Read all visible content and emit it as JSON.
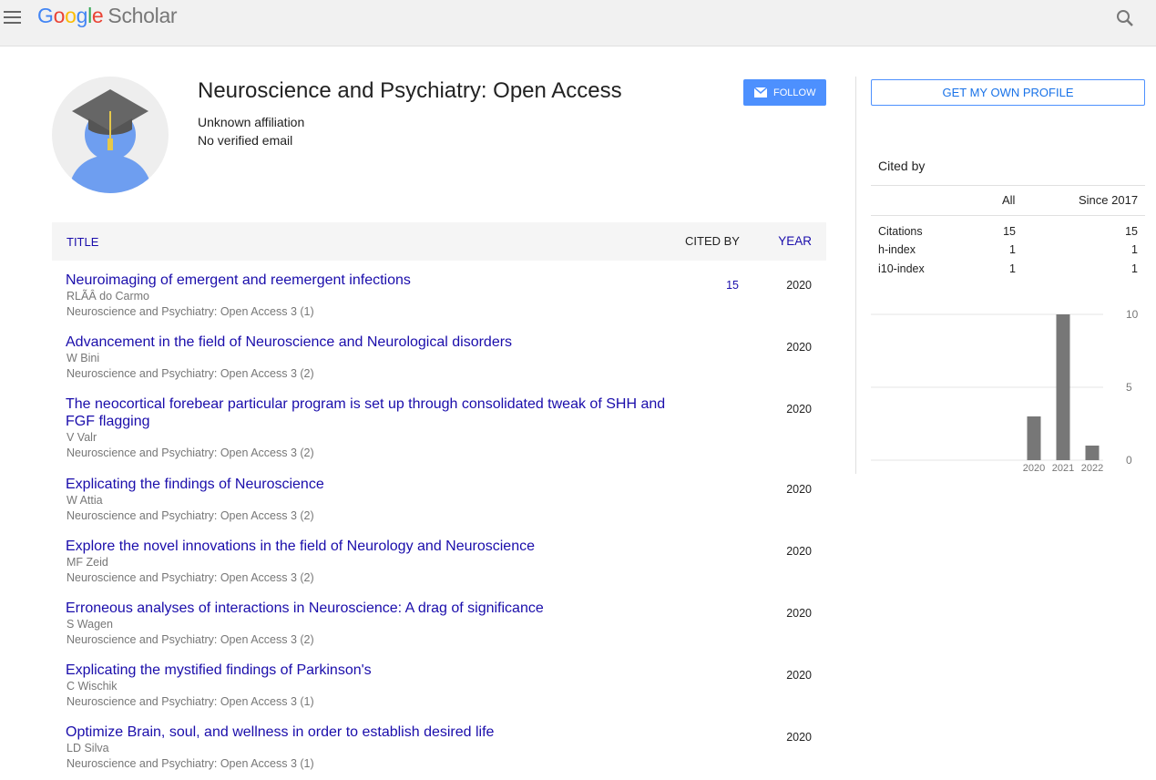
{
  "header": {
    "logo": {
      "letters": [
        "G",
        "o",
        "o",
        "g",
        "l",
        "e"
      ],
      "product": "Scholar"
    },
    "menu_icon": "hamburger-menu-icon",
    "search_icon": "search-icon"
  },
  "profile": {
    "name": "Neuroscience and Psychiatry: Open Access",
    "affiliation": "Unknown affiliation",
    "email": "No verified email",
    "follow_label": "FOLLOW"
  },
  "sidebar": {
    "own_profile_label": "GET MY OWN PROFILE",
    "cited_by_title": "Cited by",
    "columns": [
      "All",
      "Since 2017"
    ],
    "stats": [
      {
        "label": "Citations",
        "all": "15",
        "since": "15"
      },
      {
        "label": "h-index",
        "all": "1",
        "since": "1"
      },
      {
        "label": "i10-index",
        "all": "1",
        "since": "1"
      }
    ]
  },
  "table": {
    "col_title": "TITLE",
    "col_cited": "CITED BY",
    "col_year": "YEAR"
  },
  "publications": [
    {
      "title": "Neuroimaging of emergent and reemergent infections",
      "authors": "RLÃÂ do Carmo",
      "venue": "Neuroscience and Psychiatry: Open Access 3 (1)",
      "cited": "15",
      "year": "2020"
    },
    {
      "title": "Advancement in the field of Neuroscience and Neurological disorders",
      "authors": "W Bini",
      "venue": "Neuroscience and Psychiatry: Open Access 3 (2)",
      "cited": "",
      "year": "2020"
    },
    {
      "title": "The neocortical forebear particular program is set up through consolidated tweak of SHH and FGF flagging",
      "authors": "V Valr",
      "venue": "Neuroscience and Psychiatry: Open Access 3 (2)",
      "cited": "",
      "year": "2020"
    },
    {
      "title": "Explicating the findings of Neuroscience",
      "authors": "W Attia",
      "venue": "Neuroscience and Psychiatry: Open Access 3 (2)",
      "cited": "",
      "year": "2020"
    },
    {
      "title": "Explore the novel innovations in the field of Neurology and Neuroscience",
      "authors": "MF Zeid",
      "venue": "Neuroscience and Psychiatry: Open Access 3 (2)",
      "cited": "",
      "year": "2020"
    },
    {
      "title": "Erroneous analyses of interactions in Neuroscience: A drag of significance",
      "authors": "S Wagen",
      "venue": "Neuroscience and Psychiatry: Open Access 3 (2)",
      "cited": "",
      "year": "2020"
    },
    {
      "title": "Explicating the mystified findings of Parkinson's",
      "authors": "C Wischik",
      "venue": "Neuroscience and Psychiatry: Open Access 3 (1)",
      "cited": "",
      "year": "2020"
    },
    {
      "title": "Optimize Brain, soul, and wellness in order to establish desired life",
      "authors": "LD Silva",
      "venue": "Neuroscience and Psychiatry: Open Access 3 (1)",
      "cited": "",
      "year": "2020"
    }
  ],
  "chart_data": {
    "type": "bar",
    "categories": [
      "2020",
      "2021",
      "2022"
    ],
    "values": [
      3,
      10,
      1
    ],
    "yticks": [
      "10",
      "5",
      "0"
    ],
    "ylim": [
      0,
      10
    ],
    "bar_color": "#777777"
  }
}
